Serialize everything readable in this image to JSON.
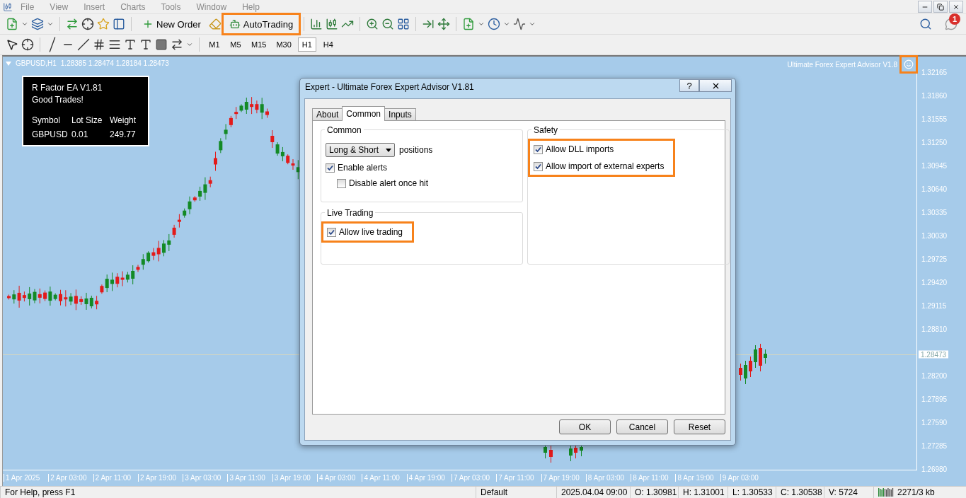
{
  "menu": [
    "File",
    "View",
    "Insert",
    "Charts",
    "Tools",
    "Window",
    "Help"
  ],
  "toolbar": {
    "new_order": "New Order",
    "auto_trading": {
      "label": "AutoTrading",
      "highlighted": true
    }
  },
  "timeframes": [
    {
      "label": "M1",
      "selected": false
    },
    {
      "label": "M5",
      "selected": false
    },
    {
      "label": "M15",
      "selected": false
    },
    {
      "label": "M30",
      "selected": false
    },
    {
      "label": "H1",
      "selected": true
    },
    {
      "label": "H4",
      "selected": false
    }
  ],
  "notifications": {
    "badge": "1"
  },
  "chart": {
    "symbol": "GBPUSD,H1",
    "ohlc": "1.28385 1.28474 1.28184 1.28473",
    "expert_label": "Ultimate Forex Expert Advisor V1.8",
    "expert_highlighted": true,
    "price_axis": [
      "1.32165",
      "1.31860",
      "1.31555",
      "1.31250",
      "1.30945",
      "1.30640",
      "1.30335",
      "1.30030",
      "1.29725",
      "1.29420",
      "1.29115",
      "1.28810",
      "1.28200",
      "1.27895",
      "1.27590",
      "1.27285",
      "1.26980"
    ],
    "current_price": "1.28473",
    "time_axis": [
      "1 Apr 2025",
      "2 Apr 03:00",
      "2 Apr 11:00",
      "2 Apr 19:00",
      "3 Apr 03:00",
      "3 Apr 11:00",
      "3 Apr 19:00",
      "4 Apr 03:00",
      "4 Apr 11:00",
      "4 Apr 19:00",
      "7 Apr 03:00",
      "7 Apr 11:00",
      "7 Apr 19:00",
      "8 Apr 03:00",
      "8 Apr 11:00",
      "8 Apr 19:00",
      "9 Apr 03:00"
    ]
  },
  "info_panel": {
    "title": "R Factor EA V1.81",
    "subtitle": "Good Trades!",
    "columns": [
      "Symbol",
      "Lot Size",
      "Weight"
    ],
    "row": [
      "GBPUSD",
      "0.01",
      "249.77"
    ]
  },
  "dialog": {
    "title": "Expert - Ultimate Forex Expert Advisor V1.81",
    "help": "?",
    "tabs": [
      {
        "label": "About",
        "selected": false
      },
      {
        "label": "Common",
        "selected": true
      },
      {
        "label": "Inputs",
        "selected": false
      }
    ],
    "common": {
      "title": "Common",
      "dropdown": "Long & Short",
      "dropdown_suffix": "positions",
      "checks": [
        {
          "label": "Enable alerts",
          "checked": true,
          "indented": false
        },
        {
          "label": "Disable alert once hit",
          "checked": false,
          "indented": true
        }
      ]
    },
    "live_trading": {
      "title": "Live Trading",
      "highlighted": true,
      "checks": [
        {
          "label": "Allow live trading",
          "checked": true
        }
      ]
    },
    "safety": {
      "title": "Safety",
      "highlighted": true,
      "checks": [
        {
          "label": "Allow DLL imports",
          "checked": true
        },
        {
          "label": "Allow import of external experts",
          "checked": true
        }
      ]
    },
    "buttons": [
      "OK",
      "Cancel",
      "Reset"
    ]
  },
  "status_bar": [
    "For Help, press F1",
    "Default",
    "2025.04.04 09:00",
    "O: 1.30981",
    "H: 1.31001",
    "L: 1.30533",
    "C: 1.30538",
    "V: 5724",
    "2271/3 kb"
  ]
}
